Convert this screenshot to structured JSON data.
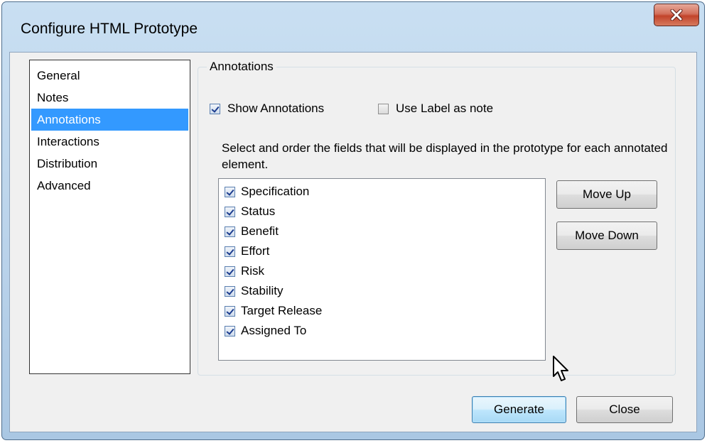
{
  "window": {
    "title": "Configure HTML Prototype"
  },
  "nav": {
    "items": [
      "General",
      "Notes",
      "Annotations",
      "Interactions",
      "Distribution",
      "Advanced"
    ],
    "selected": "Annotations"
  },
  "annotations": {
    "group_label": "Annotations",
    "show_annotations": {
      "label": "Show Annotations",
      "checked": true
    },
    "use_label_as_note": {
      "label": "Use Label as note",
      "checked": false
    },
    "instructions": "Select and order the fields that will be displayed in the prototype for each annotated element.",
    "fields": [
      {
        "label": "Specification",
        "checked": true
      },
      {
        "label": "Status",
        "checked": true
      },
      {
        "label": "Benefit",
        "checked": true
      },
      {
        "label": "Effort",
        "checked": true
      },
      {
        "label": "Risk",
        "checked": true
      },
      {
        "label": "Stability",
        "checked": true
      },
      {
        "label": "Target Release",
        "checked": true
      },
      {
        "label": "Assigned To",
        "checked": true
      }
    ],
    "move_up_label": "Move Up",
    "move_down_label": "Move Down"
  },
  "footer": {
    "generate_label": "Generate",
    "close_label": "Close"
  },
  "colors": {
    "selection": "#3399ff",
    "title_bar": "#b9d2ea",
    "close_button": "#c2432a"
  },
  "icons": {
    "close": "close-icon",
    "cursor": "mouse-pointer-icon",
    "checkbox": "checkbox-icon"
  }
}
